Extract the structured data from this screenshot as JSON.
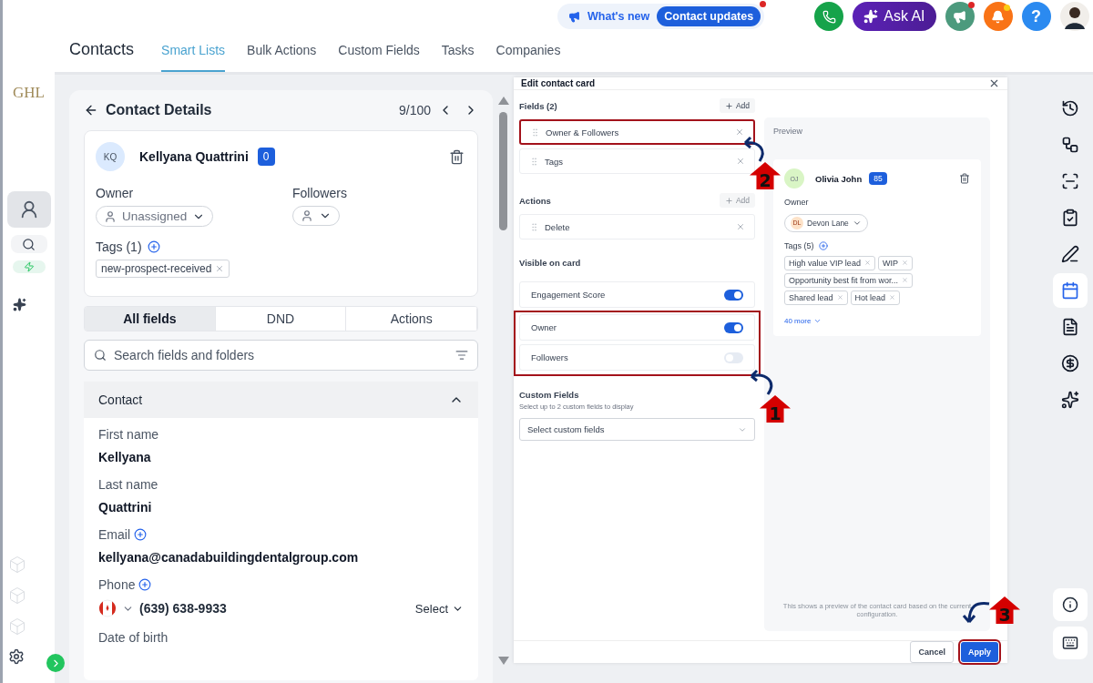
{
  "sidebar": {
    "logo": "GHL",
    "items": [
      {
        "kind": "contact",
        "selected": true
      },
      {
        "kind": "search",
        "selected": false
      },
      {
        "kind": "bolt",
        "selected": false
      },
      {
        "kind": "sparkle",
        "selected": false
      }
    ]
  },
  "top_bar": {
    "whats_new": "What's new",
    "update_pill": "Contact updates",
    "ask_ai": "Ask AI",
    "help": "?"
  },
  "nav": {
    "title": "Contacts",
    "tabs": [
      {
        "label": "Smart Lists",
        "selected": true
      },
      {
        "label": "Bulk Actions",
        "selected": false
      },
      {
        "label": "Custom Fields",
        "selected": false
      },
      {
        "label": "Tasks",
        "selected": false
      },
      {
        "label": "Companies",
        "selected": false
      }
    ]
  },
  "contact_panel": {
    "title": "Contact Details",
    "pager": "9/100",
    "card": {
      "initials": "KQ",
      "name": "Kellyana Quattrini",
      "score": "0",
      "owner_label": "Owner",
      "owner_value": "Unassigned",
      "followers_label": "Followers",
      "tags_label": "Tags (1)",
      "tags": [
        "new-prospect-received"
      ]
    },
    "tabs": [
      {
        "label": "All fields",
        "selected": true
      },
      {
        "label": "DND",
        "selected": false
      },
      {
        "label": "Actions",
        "selected": false
      }
    ],
    "search": {
      "placeholder": "Search fields and folders"
    },
    "section": {
      "title": "Contact",
      "expanded": true
    },
    "fields": [
      {
        "kind": "text",
        "label": "First name",
        "value": "Kellyana"
      },
      {
        "kind": "text",
        "label": "Last name",
        "value": "Quattrini"
      },
      {
        "kind": "add",
        "label": "Email",
        "value": "kellyana@canadabuildingdentalgroup.com"
      },
      {
        "kind": "phone",
        "label": "Phone",
        "value": "(639) 638-9933",
        "select": "Select"
      },
      {
        "kind": "text",
        "label": "Date of birth"
      }
    ]
  },
  "drawer": {
    "title": "Edit contact card",
    "fields": {
      "title": "Fields (2)",
      "add": "Add",
      "add_disabled": false,
      "items": [
        {
          "label": "Owner & Followers",
          "highlighted": true,
          "marker": "2"
        },
        {
          "label": "Tags",
          "highlighted": false
        }
      ]
    },
    "actions": {
      "title": "Actions",
      "add": "Add",
      "add_disabled": true,
      "items": [
        {
          "label": "Delete",
          "highlighted": false
        }
      ]
    },
    "visible_on_card": {
      "title": "Visible on card",
      "marker": "1",
      "items": [
        {
          "label": "Engagement Score",
          "on": true,
          "highlighted": false
        },
        {
          "label": "Owner",
          "on": true,
          "highlighted": true
        },
        {
          "label": "Followers",
          "on": false,
          "highlighted": true
        }
      ]
    },
    "custom_fields": {
      "title": "Custom Fields",
      "hint": "Select up to 2 custom fields to display",
      "placeholder": "Select custom fields"
    },
    "preview": {
      "title": "Preview",
      "initials": "OJ",
      "name": "Olivia John",
      "score": "85",
      "owner_label": "Owner",
      "owner_initials": "DL",
      "owner_name": "Devon Lane",
      "tags_label": "Tags (5)",
      "tags": [
        "High value VIP lead",
        "WIP",
        "Opportunity best fit from wor...",
        "Shared lead",
        "Hot lead"
      ],
      "more": "40 more",
      "note": "This shows a preview of the contact card based on the current configuration."
    },
    "buttons": [
      {
        "kind": "secondary",
        "label": "Cancel",
        "highlighted": false
      },
      {
        "kind": "primary",
        "label": "Apply",
        "highlighted": true,
        "marker": "3"
      }
    ]
  },
  "right_rail": {
    "items": [
      {
        "kind": "history",
        "selected": false
      },
      {
        "kind": "workflow",
        "selected": false
      },
      {
        "kind": "scan",
        "selected": false
      },
      {
        "kind": "clipboard",
        "selected": false
      },
      {
        "kind": "pen",
        "selected": false
      },
      {
        "kind": "calendar",
        "selected": true
      },
      {
        "kind": "file",
        "selected": false
      },
      {
        "kind": "dollar",
        "selected": false
      },
      {
        "kind": "sparkles",
        "selected": false
      }
    ],
    "bottom": [
      {
        "kind": "info"
      },
      {
        "kind": "keyboard"
      }
    ]
  }
}
